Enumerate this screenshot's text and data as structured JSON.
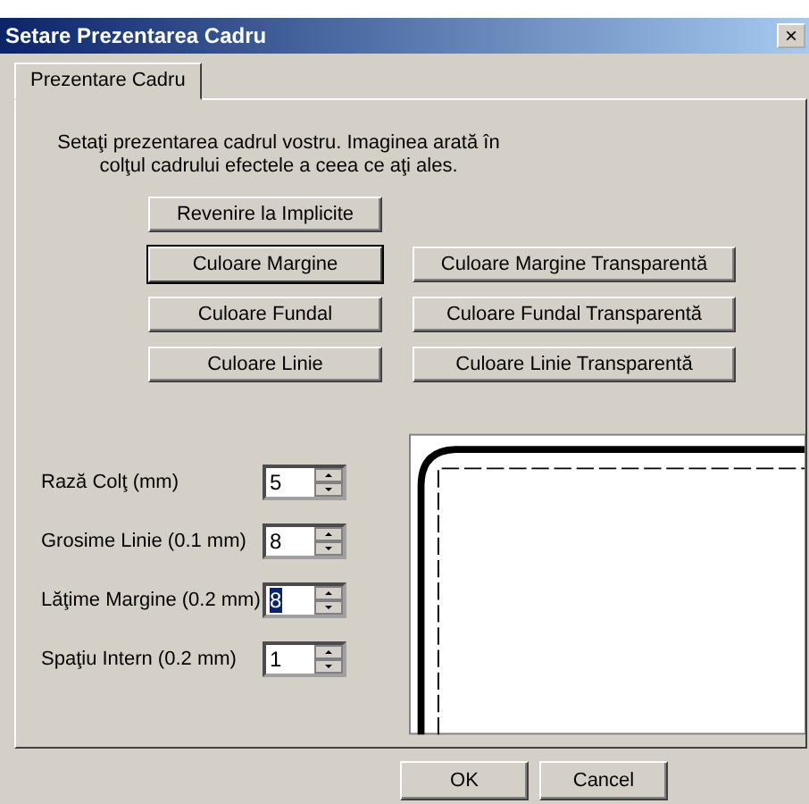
{
  "window": {
    "title": "Setare Prezentarea Cadru",
    "close": "×"
  },
  "tabs": [
    {
      "label": "Prezentare Cadru",
      "selected": true
    }
  ],
  "description": "Setaţi prezentarea cadrul vostru. Imaginea arată  în colţul cadrului efectele a ceea ce aţi ales.",
  "reset_button": {
    "label": "Revenire la Implicite",
    "default": false
  },
  "color_buttons": [
    {
      "label": "Culoare Margine",
      "default": true
    },
    {
      "label": "Culoare Margine Transparentă",
      "default": false
    },
    {
      "label": "Culoare Fundal",
      "default": false
    },
    {
      "label": "Culoare Fundal Transparentă",
      "default": false
    },
    {
      "label": "Culoare Linie",
      "default": false
    },
    {
      "label": "Culoare Linie Transparentă",
      "default": false
    }
  ],
  "fields": [
    {
      "label": "Rază Colţ (mm)",
      "value": "5",
      "focused": false
    },
    {
      "label": "Grosime Linie (0.1 mm)",
      "value": "8",
      "focused": false
    },
    {
      "label": "Lăţime Margine (0.2 mm)",
      "value": "8",
      "focused": true
    },
    {
      "label": "Spaţiu Intern (0.2 mm)",
      "value": "1",
      "focused": false
    }
  ],
  "buttons": [
    {
      "label": "OK"
    },
    {
      "label": "Cancel"
    }
  ]
}
